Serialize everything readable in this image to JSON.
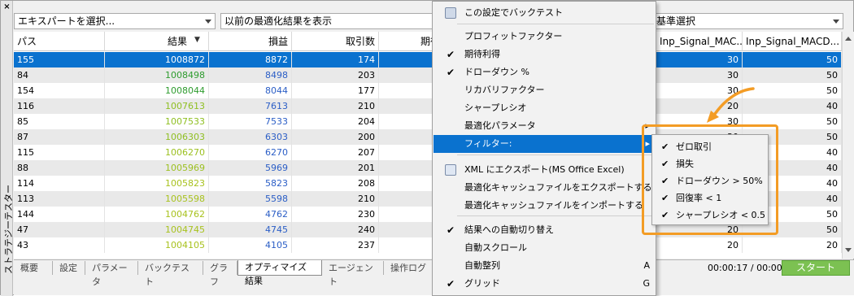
{
  "sidebar": {
    "close": "×",
    "title": "ストラテジーテスター"
  },
  "toolbar": {
    "expert_select": "エキスパートを選択...",
    "prev_results": "以前の最適化結果を表示",
    "right_select": "基準選択"
  },
  "table": {
    "headers": [
      "パス",
      "結果",
      "損益",
      "取引数",
      "期待",
      "",
      "Inp_Signal_MAC...",
      "Inp_Signal_MACD..."
    ],
    "rows": [
      [
        "155",
        "1008872",
        "8872",
        "174",
        "",
        "",
        "30",
        "50"
      ],
      [
        "84",
        "1008498",
        "8498",
        "203",
        "",
        "",
        "30",
        "50"
      ],
      [
        "154",
        "1008044",
        "8044",
        "177",
        "",
        "",
        "30",
        "50"
      ],
      [
        "116",
        "1007613",
        "7613",
        "210",
        "",
        "",
        "20",
        "40"
      ],
      [
        "85",
        "1007533",
        "7533",
        "204",
        "",
        "",
        "30",
        "50"
      ],
      [
        "87",
        "1006303",
        "6303",
        "200",
        "",
        "",
        "30",
        "50"
      ],
      [
        "115",
        "1006270",
        "6270",
        "207",
        "",
        "",
        "30",
        "40"
      ],
      [
        "88",
        "1005969",
        "5969",
        "201",
        "",
        "",
        "30",
        "40"
      ],
      [
        "114",
        "1005823",
        "5823",
        "208",
        "",
        "",
        "30",
        "40"
      ],
      [
        "113",
        "1005598",
        "5598",
        "210",
        "",
        "",
        "30",
        "40"
      ],
      [
        "144",
        "1004762",
        "4762",
        "230",
        "",
        "",
        "30",
        "50"
      ],
      [
        "47",
        "1004745",
        "4745",
        "240",
        "",
        "",
        "20",
        "50"
      ],
      [
        "43",
        "1004105",
        "4105",
        "237",
        "",
        "",
        "20",
        "20"
      ]
    ],
    "result_colors": [
      "#ffffff",
      "#2e9c2e",
      "#2e9c2e",
      "#8fbf22",
      "#8fbf22",
      "#8fbf22",
      "#9cc020",
      "#9cc020",
      "#a8c21e",
      "#a8c21e",
      "#a8c21e",
      "#a8c21e",
      "#a8c21e"
    ],
    "selected_row": 0,
    "sort_arrow": "▼"
  },
  "tabs": [
    "概要",
    "設定",
    "パラメータ",
    "バックテスト",
    "グラフ",
    "オプティマイズ結果",
    "エージェント",
    "操作ログ"
  ],
  "active_tab": 5,
  "status": {
    "timer": "00:00:17 / 00:00:17",
    "start": "スタート"
  },
  "menu": {
    "items": [
      {
        "label": "この設定でバックテスト",
        "check": "",
        "shortcut": "",
        "icon": "backtest-icon"
      },
      {
        "label": "プロフィットファクター",
        "check": "",
        "shortcut": ""
      },
      {
        "label": "期待利得",
        "check": "✔",
        "shortcut": ""
      },
      {
        "label": "ドローダウン %",
        "check": "✔",
        "shortcut": ""
      },
      {
        "label": "リカバリファクター",
        "check": "",
        "shortcut": ""
      },
      {
        "label": "シャープレシオ",
        "check": "",
        "shortcut": ""
      },
      {
        "label": "最適化パラメータ",
        "check": "",
        "shortcut": "",
        "arrow": "▸"
      },
      {
        "label": "フィルター:",
        "check": "",
        "shortcut": "",
        "arrow": "▸"
      },
      {
        "label": "XML にエクスポート(MS Office Excel)",
        "check": "",
        "shortcut": "",
        "icon": "xml-icon"
      },
      {
        "label": "最適化キャッシュファイルをエクスポートする",
        "check": "",
        "shortcut": ""
      },
      {
        "label": "最適化キャッシュファイルをインポートする",
        "check": "",
        "shortcut": ""
      },
      {
        "label": "結果への自動切り替え",
        "check": "✔",
        "shortcut": ""
      },
      {
        "label": "自動スクロール",
        "check": "",
        "shortcut": ""
      },
      {
        "label": "自動整列",
        "check": "",
        "shortcut": "A"
      },
      {
        "label": "グリッド",
        "check": "✔",
        "shortcut": "G"
      }
    ]
  },
  "submenu": {
    "items": [
      {
        "label": "ゼロ取引",
        "check": "✔"
      },
      {
        "label": "損失",
        "check": "✔"
      },
      {
        "label": "ドローダウン > 50%",
        "check": "✔"
      },
      {
        "label": "回復率 < 1",
        "check": "✔"
      },
      {
        "label": "シャープレシオ < 0.5",
        "check": "✔"
      }
    ]
  },
  "colors": {
    "accent": "#0a72cf",
    "highlight_border": "#f39c25",
    "start_button": "#7cc152",
    "profit_text": "#2b5ec6"
  }
}
